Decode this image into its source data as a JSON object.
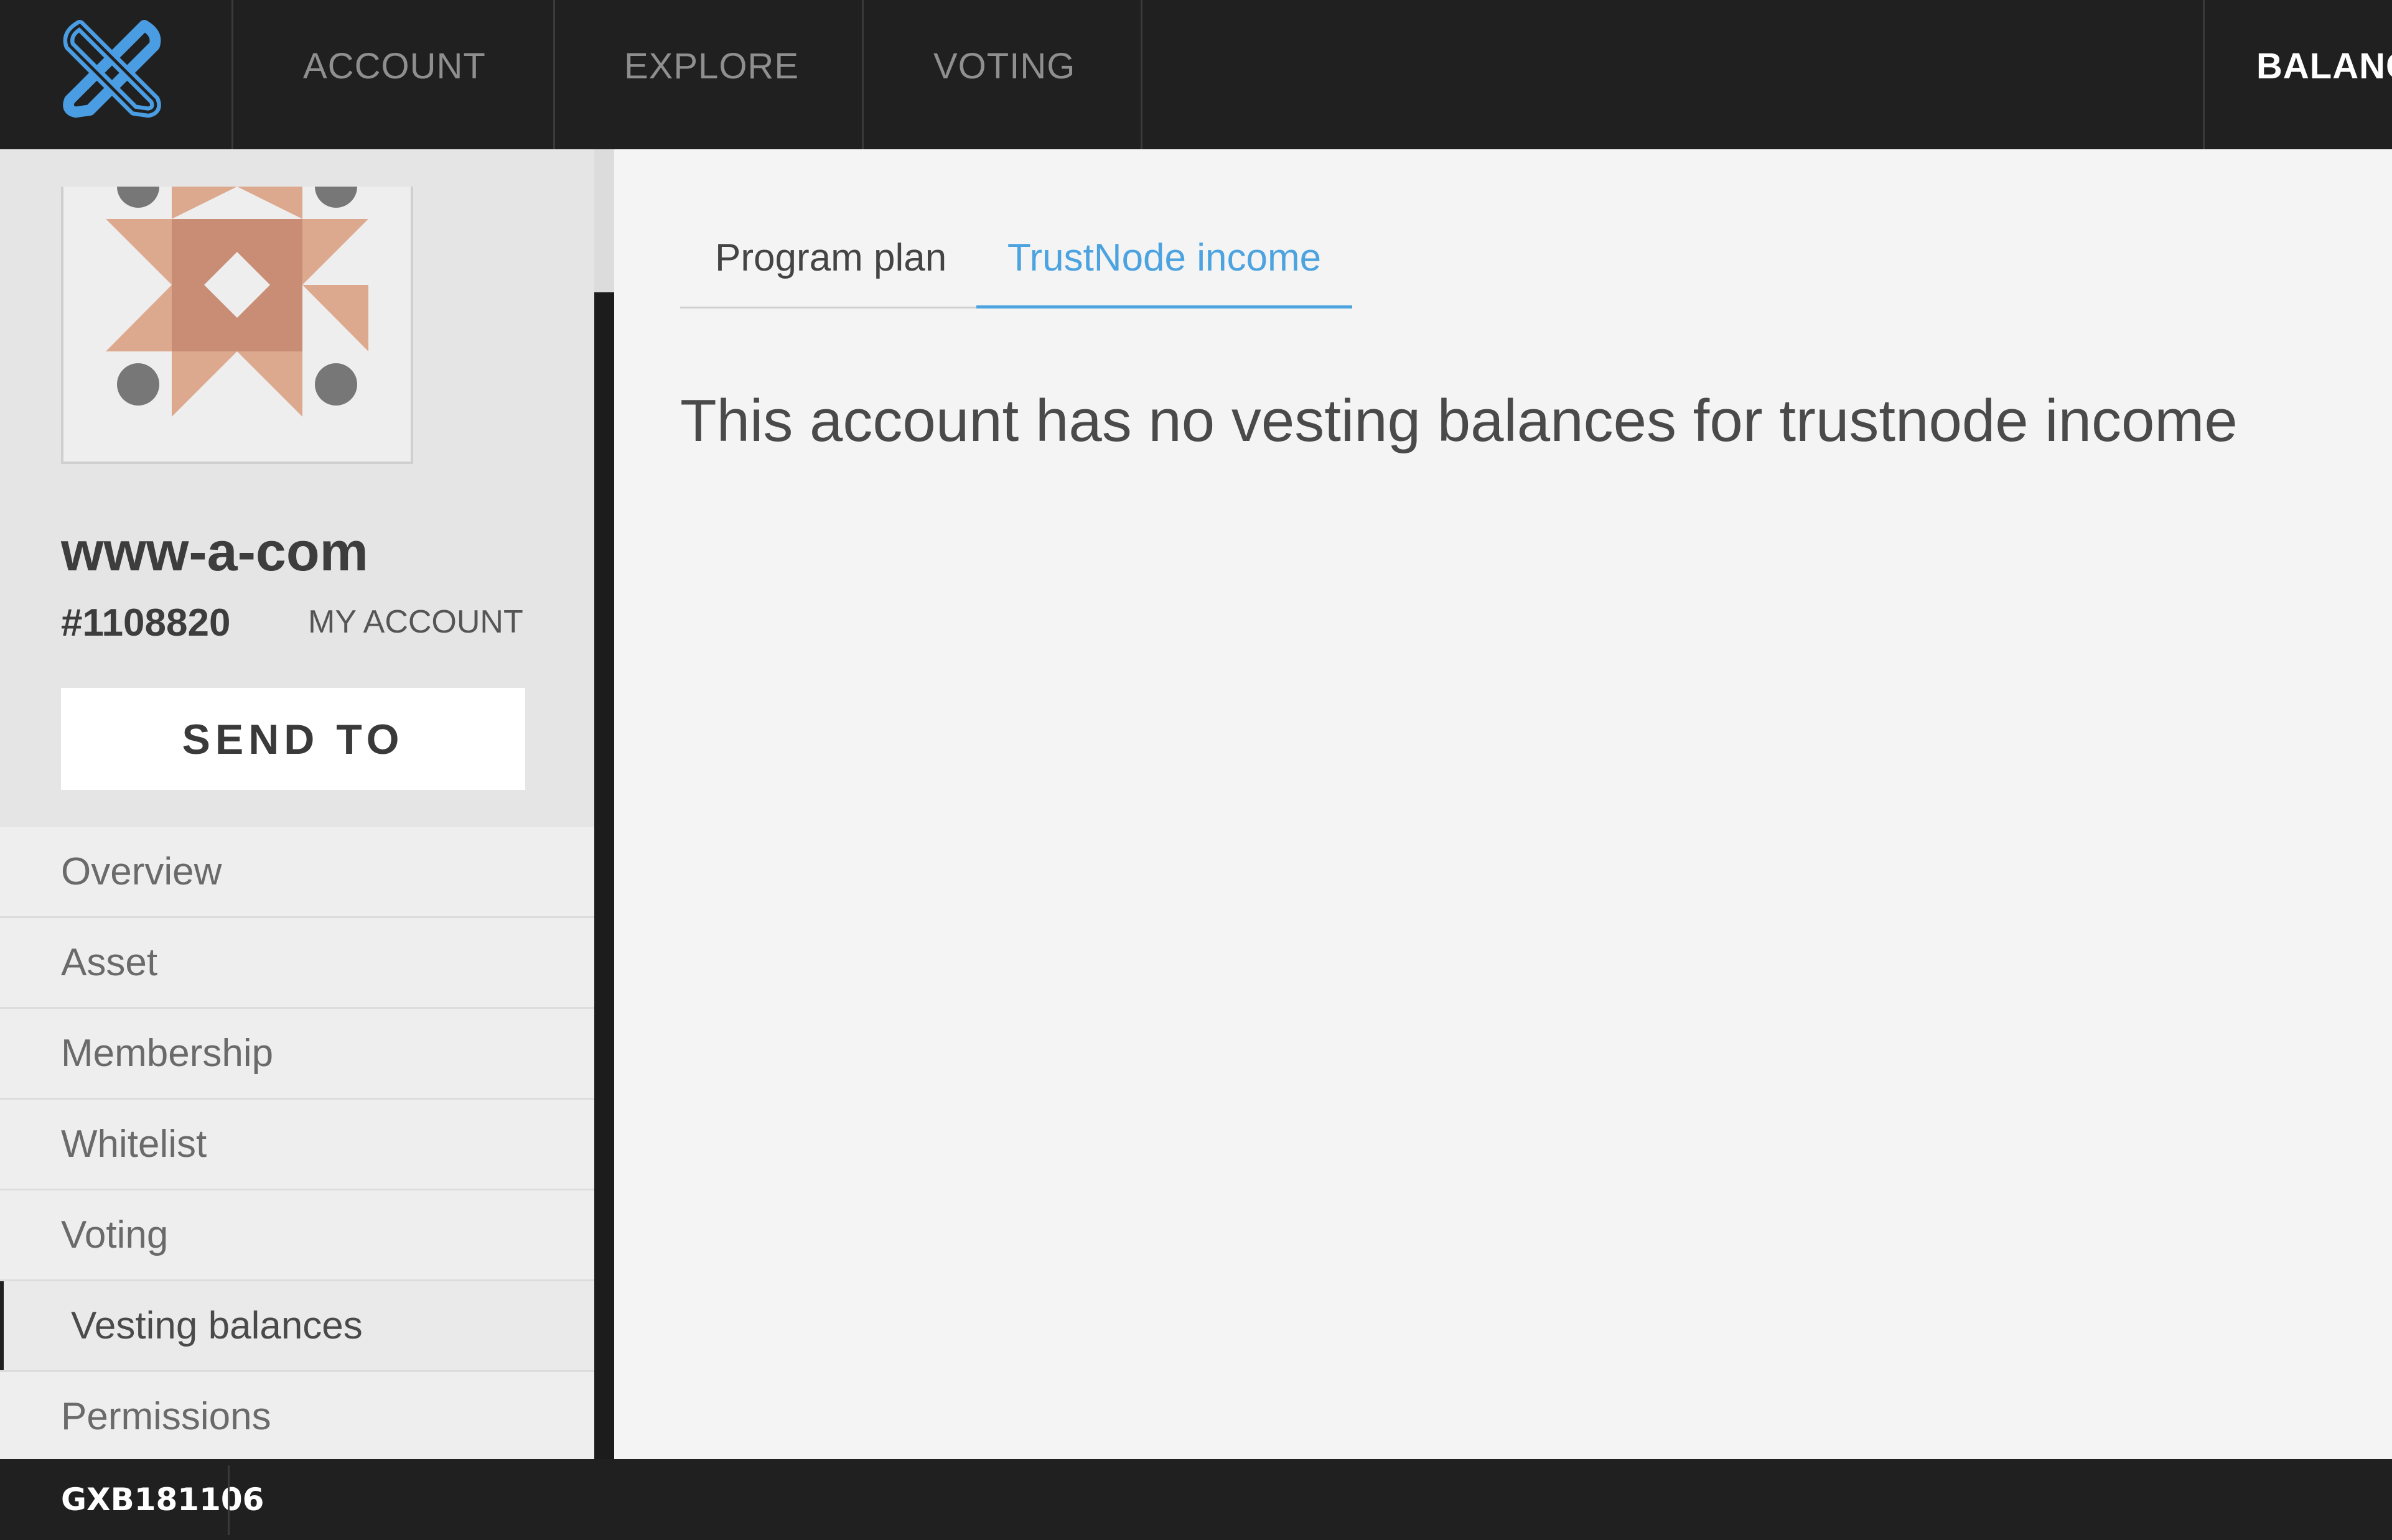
{
  "app": {
    "logo_icon": "gxchain-x-logo",
    "accent_color": "#4ca3e0"
  },
  "topnav": {
    "items": [
      {
        "label": "ACCOUNT"
      },
      {
        "label": "EXPLORE"
      },
      {
        "label": "VOTING"
      }
    ],
    "right_label": "BALANC"
  },
  "sidebar": {
    "avatar_icon": "identicon-avatar",
    "account_name": "www-a-com",
    "account_id": "#1108820",
    "my_account_label": "MY ACCOUNT",
    "send_button_label": "SEND TO",
    "menu": [
      {
        "label": "Overview"
      },
      {
        "label": "Asset"
      },
      {
        "label": "Membership"
      },
      {
        "label": "Whitelist"
      },
      {
        "label": "Voting"
      },
      {
        "label": "Vesting balances",
        "active": true
      },
      {
        "label": "Permissions"
      }
    ]
  },
  "main": {
    "tabs": [
      {
        "label": "Program plan"
      },
      {
        "label": "TrustNode income",
        "active": true
      }
    ],
    "message": "This account has no vesting balances for trustnode income"
  },
  "footer": {
    "version": "GXB181106"
  }
}
